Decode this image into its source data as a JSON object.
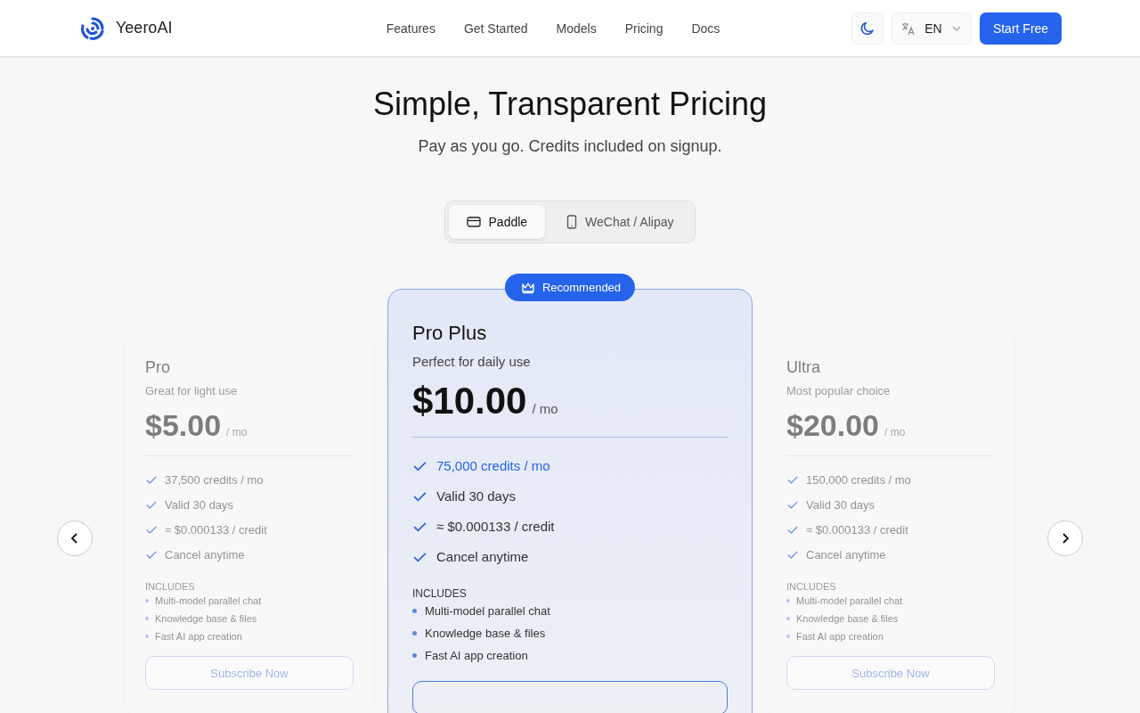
{
  "header": {
    "brand": "YeeroAI",
    "nav": [
      "Features",
      "Get Started",
      "Models",
      "Pricing",
      "Docs"
    ],
    "language": "EN",
    "cta": "Start Free"
  },
  "hero": {
    "title": "Simple, Transparent Pricing",
    "subtitle": "Pay as you go. Credits included on signup."
  },
  "payment_tabs": [
    {
      "label": "Paddle",
      "kind": "card",
      "selected": true
    },
    {
      "label": "WeChat / Alipay",
      "kind": "phone",
      "selected": false
    }
  ],
  "plans": [
    {
      "name": "Pro",
      "tagline": "Great for light use",
      "price": "$5.00",
      "period": "/ mo",
      "selected": false,
      "features": [
        "37,500 credits / mo",
        "Valid 30 days",
        "≈ $0.000133 / credit",
        "Cancel anytime"
      ],
      "includes_label": "INCLUDES",
      "includes": [
        "Multi-model parallel chat",
        "Knowledge base & files",
        "Fast AI app creation"
      ],
      "button": "Subscribe Now"
    },
    {
      "name": "Pro Plus",
      "badge": "Recommended",
      "tagline": "Perfect for daily use",
      "price": "$10.00",
      "period": "/ mo",
      "selected": true,
      "features": [
        "75,000 credits / mo",
        "Valid 30 days",
        "≈ $0.000133 / credit",
        "Cancel anytime"
      ],
      "includes_label": "INCLUDES",
      "includes": [
        "Multi-model parallel chat",
        "Knowledge base & files",
        "Fast AI app creation"
      ]
    },
    {
      "name": "Ultra",
      "tagline": "Most popular choice",
      "price": "$20.00",
      "period": "/ mo",
      "selected": false,
      "features": [
        "150,000 credits / mo",
        "Valid 30 days",
        "≈ $0.000133 / credit",
        "Cancel anytime"
      ],
      "includes_label": "INCLUDES",
      "includes": [
        "Multi-model parallel chat",
        "Knowledge base & files",
        "Fast AI app creation"
      ],
      "button": "Subscribe Now"
    }
  ]
}
